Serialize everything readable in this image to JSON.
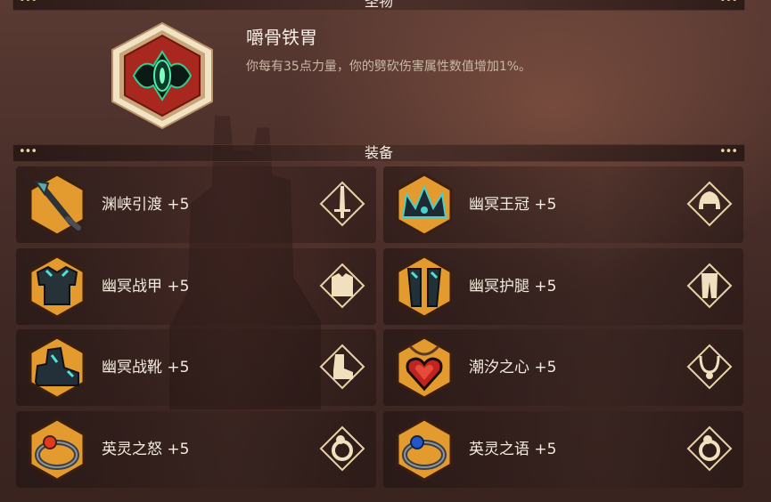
{
  "relic_section": {
    "title": "圣物",
    "name": "嚼骨铁胃",
    "description": "你每有35点力量，你的劈砍伤害属性数值增加1%。",
    "icon": "relic-emblem-icon"
  },
  "equipment_section": {
    "title": "装备",
    "items": [
      {
        "label": "渊峡引渡 +5",
        "icon": "polearm-icon",
        "slot_icon": "sword-slot-icon"
      },
      {
        "label": "幽冥王冠 +5",
        "icon": "crown-icon",
        "slot_icon": "helmet-slot-icon"
      },
      {
        "label": "幽冥战甲 +5",
        "icon": "armor-icon",
        "slot_icon": "chest-slot-icon"
      },
      {
        "label": "幽冥护腿 +5",
        "icon": "greaves-icon",
        "slot_icon": "legs-slot-icon"
      },
      {
        "label": "幽冥战靴 +5",
        "icon": "boots-icon",
        "slot_icon": "boots-slot-icon"
      },
      {
        "label": "潮汐之心 +5",
        "icon": "heart-amulet-icon",
        "slot_icon": "necklace-slot-icon"
      },
      {
        "label": "英灵之怒 +5",
        "icon": "ring-red-icon",
        "slot_icon": "ring-slot-icon"
      },
      {
        "label": "英灵之语 +5",
        "icon": "ring-blue-icon",
        "slot_icon": "ring-slot-icon"
      }
    ]
  },
  "colors": {
    "frame_gold": "#e8d3a6",
    "hex_orange": "#e39a2e",
    "background": "#4a2f2a"
  }
}
